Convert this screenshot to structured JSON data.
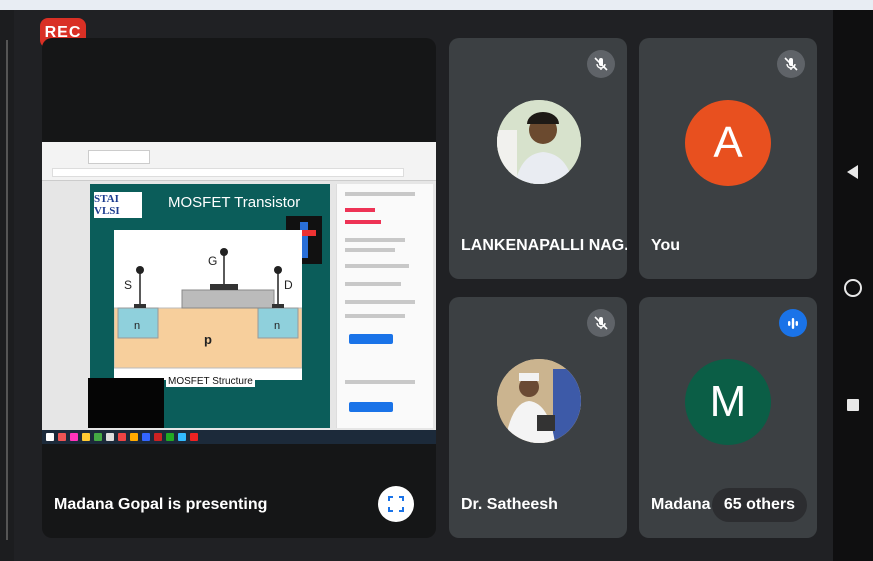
{
  "recording_badge": "REC",
  "presentation": {
    "status_text": "Madana Gopal is presenting",
    "slide_title": "MOSFET Transistor",
    "slide_logo": "STAI VLSI",
    "slide_subtitle": "MOSFET Structure",
    "terminal_labels": {
      "source": "S",
      "gate": "G",
      "drain": "D",
      "n_left": "n",
      "n_right": "n",
      "substrate": "p"
    }
  },
  "participants": [
    {
      "name": "LANKENAPALLI NAG...",
      "muted": true,
      "avatar": "photo",
      "avatar_color": "#c8d6b9"
    },
    {
      "name": "You",
      "muted": true,
      "avatar_letter": "A",
      "avatar_color": "#e8501f"
    },
    {
      "name": "Dr. Satheesh",
      "muted": true,
      "avatar": "photo",
      "avatar_color": "#d2c1a8"
    },
    {
      "name": "Madana G",
      "speaking": true,
      "avatar_letter": "M",
      "avatar_color": "#0b5e46"
    }
  ],
  "others_chip": "65 others",
  "colors": {
    "background": "#202124",
    "tile": "#3c4043",
    "rec": "#d93025",
    "speaking": "#1a73e8"
  },
  "icons": [
    "mic-off-icon",
    "speaking-indicator-icon",
    "fullscreen-icon",
    "back-icon",
    "home-icon",
    "recents-icon"
  ]
}
